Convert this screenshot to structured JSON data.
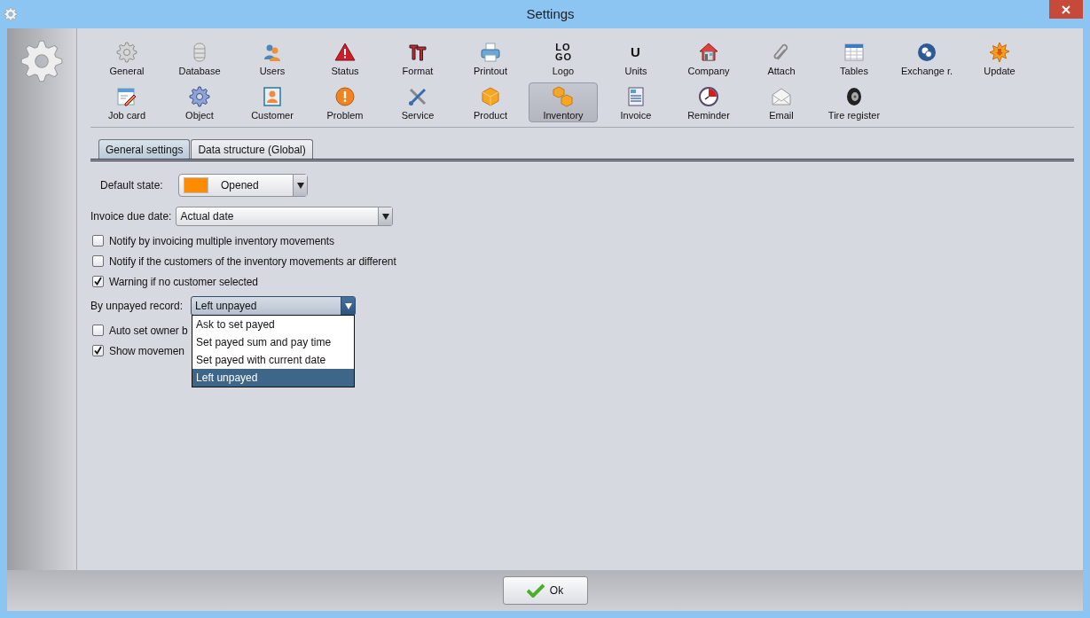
{
  "window": {
    "title": "Settings"
  },
  "toolbar": {
    "items": [
      {
        "label": "General",
        "selected": false
      },
      {
        "label": "Database",
        "selected": false
      },
      {
        "label": "Users",
        "selected": false
      },
      {
        "label": "Status",
        "selected": false
      },
      {
        "label": "Format",
        "selected": false
      },
      {
        "label": "Printout",
        "selected": false
      },
      {
        "label": "Logo",
        "selected": false,
        "icon_text": "LO GO"
      },
      {
        "label": "Units",
        "selected": false,
        "icon_text": "U"
      },
      {
        "label": "Company",
        "selected": false
      },
      {
        "label": "Attach",
        "selected": false
      },
      {
        "label": "Tables",
        "selected": false
      },
      {
        "label": "Exchange r.",
        "selected": false
      },
      {
        "label": "Update",
        "selected": false
      },
      {
        "label": "Job card",
        "selected": false
      },
      {
        "label": "Object",
        "selected": false
      },
      {
        "label": "Customer",
        "selected": false
      },
      {
        "label": "Problem",
        "selected": false
      },
      {
        "label": "Service",
        "selected": false
      },
      {
        "label": "Product",
        "selected": false
      },
      {
        "label": "Inventory",
        "selected": true
      },
      {
        "label": "Invoice",
        "selected": false
      },
      {
        "label": "Reminder",
        "selected": false
      },
      {
        "label": "Email",
        "selected": false
      },
      {
        "label": "Tire register",
        "selected": false
      }
    ]
  },
  "tabs": [
    {
      "label": "General settings",
      "selected": true
    },
    {
      "label": "Data structure (Global)",
      "selected": false
    }
  ],
  "settings": [
    {
      "kind": "state-select",
      "label": "Default state:",
      "value": "Opened",
      "color": "#ff8c00",
      "expanded": false
    },
    {
      "kind": "select",
      "label": "Invoice due date:",
      "value": "Actual date",
      "expanded": false
    },
    {
      "kind": "checkbox",
      "label": "Notify by invoicing multiple inventory movements",
      "checked": false
    },
    {
      "kind": "checkbox",
      "label": "Notify if the customers of the inventory movements ar different",
      "checked": false
    },
    {
      "kind": "checkbox",
      "label": "Warning if no customer selected",
      "checked": true
    },
    {
      "kind": "select",
      "label": "By unpayed record:",
      "value": "Left unpayed",
      "expanded": true,
      "options": [
        {
          "label": "Ask to set payed",
          "selected": false
        },
        {
          "label": "Set payed sum and pay time",
          "selected": false
        },
        {
          "label": "Set payed with current date",
          "selected": false
        },
        {
          "label": "Left unpayed",
          "selected": true
        }
      ]
    },
    {
      "kind": "checkbox",
      "label": "Auto set owner b",
      "checked": false
    },
    {
      "kind": "checkbox",
      "label": "Show movemen",
      "checked": true
    }
  ],
  "buttons": [
    {
      "label": "Ok"
    }
  ]
}
